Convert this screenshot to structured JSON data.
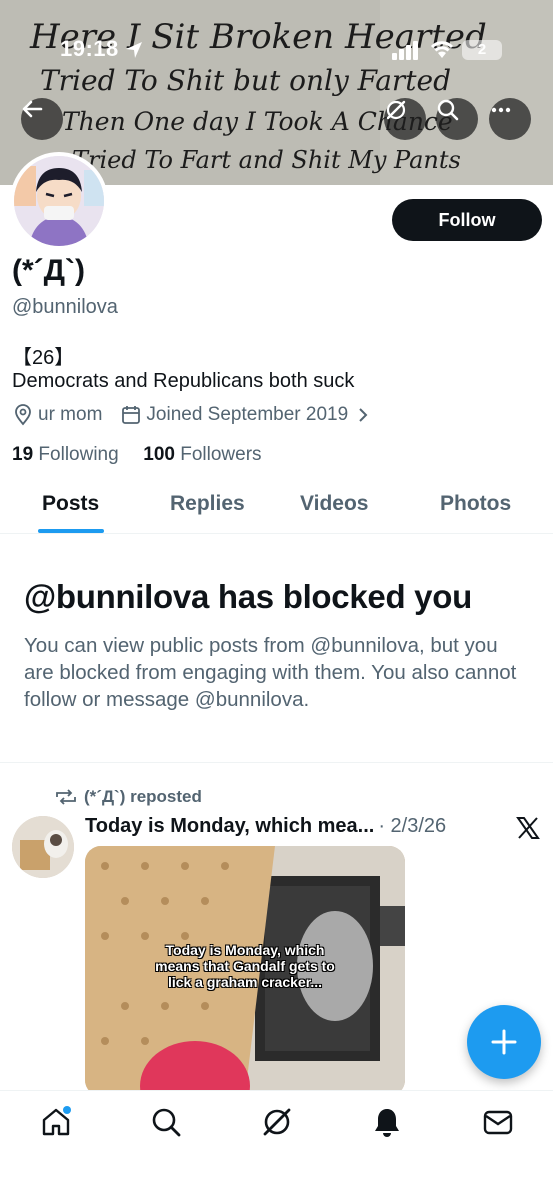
{
  "status_bar": {
    "time": "19:18",
    "battery": "2"
  },
  "banner": {
    "line1": "Here I Sit Broken Hearted",
    "line2": "Tried To Shit but only Farted",
    "line3": "Then One day I Took A Chance",
    "line4": "Tried To Fart and Shit My Pants"
  },
  "profile": {
    "follow_label": "Follow",
    "display_name": "(*´Д`)",
    "handle": "@bunnilova",
    "bio_line1": "【26】",
    "bio_line2": "Democrats and Republicans both suck",
    "location": "ur mom",
    "joined": "Joined September 2019",
    "following_count": "19",
    "following_label": "Following",
    "followers_count": "100",
    "followers_label": "Followers"
  },
  "tabs": [
    {
      "label": "Posts",
      "active": true
    },
    {
      "label": "Replies",
      "active": false
    },
    {
      "label": "Videos",
      "active": false
    },
    {
      "label": "Photos",
      "active": false
    }
  ],
  "blocked": {
    "title": "@bunnilova has blocked you",
    "text": "You can view public posts from @bunnilova, but you are blocked from engaging with them. You also cannot follow or message @bunnilova."
  },
  "post": {
    "repost_label": "(*´Д`) reposted",
    "title": "Today is Monday, which mea...",
    "date": "· 2/3/26",
    "caption": "Today is Monday, which means that Gandalf gets to lick a graham cracker..."
  },
  "colors": {
    "accent": "#1d9bf0",
    "text_primary": "#0f1419",
    "text_secondary": "#536471"
  },
  "icons": {
    "nav": [
      "home-icon",
      "search-icon",
      "grok-icon",
      "notifications-icon",
      "messages-icon"
    ],
    "header": [
      "back-arrow-icon",
      "grok-icon",
      "search-icon",
      "more-icon"
    ]
  }
}
